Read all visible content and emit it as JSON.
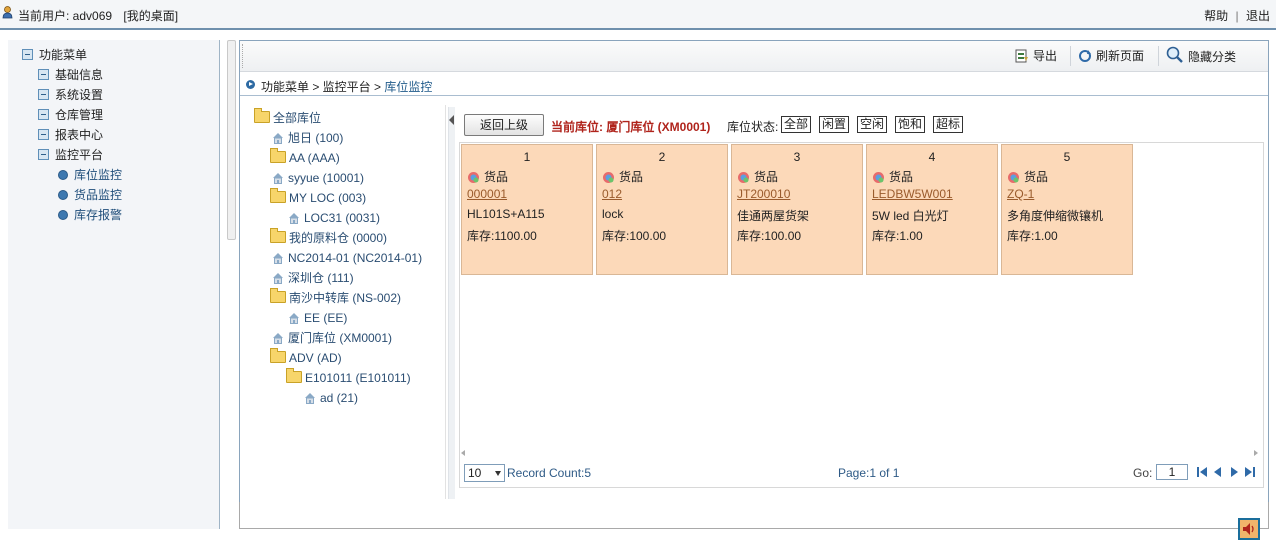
{
  "topbar": {
    "user_label": "当前用户: adv069",
    "desktop_link": "[我的桌面]",
    "help": "帮助",
    "sep": "|",
    "logout": "退出"
  },
  "menu": {
    "root": "功能菜单",
    "items": [
      {
        "label": "基础信息"
      },
      {
        "label": "系统设置"
      },
      {
        "label": "仓库管理"
      },
      {
        "label": "报表中心"
      },
      {
        "label": "监控平台"
      }
    ],
    "sub": [
      {
        "label": "库位监控"
      },
      {
        "label": "货品监控"
      },
      {
        "label": "库存报警"
      }
    ]
  },
  "toolbar": {
    "export": "导出",
    "refresh": "刷新页面",
    "hide": "隐藏分类"
  },
  "breadcrumb": {
    "path": "功能菜单 > 监控平台 > ",
    "current": "库位监控"
  },
  "tree": [
    {
      "label": "全部库位",
      "icon": "folder"
    },
    {
      "label": "旭日 (100)",
      "icon": "house"
    },
    {
      "label": "AA (AAA)",
      "icon": "folder"
    },
    {
      "label": "syyue (10001)",
      "icon": "house"
    },
    {
      "label": "MY LOC (003)",
      "icon": "folder"
    },
    {
      "label": "LOC31 (0031)",
      "icon": "house"
    },
    {
      "label": "我的原料仓 (0000)",
      "icon": "folder"
    },
    {
      "label": "NC2014-01 (NC2014-01)",
      "icon": "house"
    },
    {
      "label": "深圳仓 (111)",
      "icon": "house"
    },
    {
      "label": "南沙中转库 (NS-002)",
      "icon": "folder"
    },
    {
      "label": "EE (EE)",
      "icon": "house"
    },
    {
      "label": "厦门库位 (XM0001)",
      "icon": "house"
    },
    {
      "label": "ADV (AD)",
      "icon": "folder"
    },
    {
      "label": "E101011 (E101011)",
      "icon": "folder"
    },
    {
      "label": "ad (21)",
      "icon": "house"
    }
  ],
  "controls": {
    "back": "返回上级",
    "current_location": "当前库位: 厦门库位 (XM0001)",
    "status_label": "库位状态:",
    "status_buttons": [
      "全部",
      "闲置",
      "空闲",
      "饱和",
      "超标"
    ]
  },
  "cards": [
    {
      "num": "1",
      "type": "货品",
      "code": "000001",
      "name": "HL101S+A115",
      "stock": "库存:1100.00"
    },
    {
      "num": "2",
      "type": "货品",
      "code": "012",
      "name": "lock",
      "stock": "库存:100.00"
    },
    {
      "num": "3",
      "type": "货品",
      "code": "JT200010",
      "name": "佳通两屋货架",
      "stock": "库存:100.00"
    },
    {
      "num": "4",
      "type": "货品",
      "code": "LEDBW5W001",
      "name": "5W led 白光灯",
      "stock": "库存:1.00"
    },
    {
      "num": "5",
      "type": "货品",
      "code": "ZQ-1",
      "name": "多角度伸缩微镶机",
      "stock": "库存:1.00"
    }
  ],
  "pager": {
    "page_size": "10",
    "record_count": "Record Count:5",
    "page_info": "Page:1 of 1",
    "go_label": "Go:",
    "go_value": "1"
  },
  "colors": {
    "card_bg": "#fcd9b9",
    "current_location": "#b0241c",
    "link": "#2e5a86"
  }
}
